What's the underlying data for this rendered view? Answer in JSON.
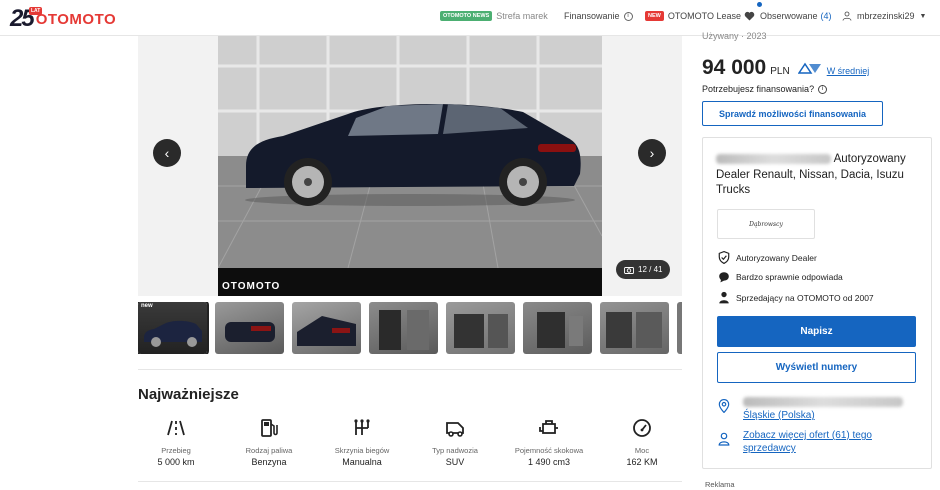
{
  "header": {
    "logo_25": "25",
    "logo_lat": "LAT",
    "logo_text": "OTOMOTO",
    "nav_news_badge": "OTOMOTO NEWS",
    "nav_strefa": "Strefa marek",
    "nav_finansowanie": "Finansowanie",
    "nav_new_badge": "NEW",
    "nav_lease": "OTOMOTO Lease",
    "nav_obserwowane": "Obserwowane",
    "nav_obserwowane_count": "(4)",
    "nav_user": "mbrzezinski29"
  },
  "gallery": {
    "watermark": "OTOMOTO",
    "counter": "12 / 41",
    "thumb_badge": "new"
  },
  "listing": {
    "status_line": "Używany · 2023",
    "price": "94 000",
    "currency": "PLN",
    "price_rating": "W średniej",
    "financing_question": "Potrzebujesz finansowania?",
    "financing_button": "Sprawdź możliwości finansowania"
  },
  "highlights": {
    "title": "Najważniejsze",
    "specs": [
      {
        "label": "Przebieg",
        "value": "5 000 km",
        "icon": "road-icon"
      },
      {
        "label": "Rodzaj paliwa",
        "value": "Benzyna",
        "icon": "fuel-pump-icon"
      },
      {
        "label": "Skrzynia biegów",
        "value": "Manualna",
        "icon": "gearbox-icon"
      },
      {
        "label": "Typ nadwozia",
        "value": "SUV",
        "icon": "car-body-icon"
      },
      {
        "label": "Pojemność skokowa",
        "value": "1 490 cm3",
        "icon": "engine-icon"
      },
      {
        "label": "Moc",
        "value": "162 KM",
        "icon": "speedometer-icon"
      }
    ]
  },
  "seller": {
    "name_suffix": "Autoryzowany Dealer Renault, Nissan, Dacia, Isuzu Trucks",
    "logo_text": "Dąbrowscy",
    "features": [
      {
        "text": "Autoryzowany Dealer",
        "icon": "shield-check-icon"
      },
      {
        "text": "Bardzo sprawnie odpowiada",
        "icon": "chat-bubble-icon"
      },
      {
        "text": "Sprzedający na OTOMOTO od 2007",
        "icon": "person-icon"
      }
    ],
    "write_button": "Napisz",
    "show_numbers_button": "Wyświetl numery",
    "location_suffix": "Śląskie (Polska)",
    "more_offers": "Zobacz więcej ofert (61) tego sprzedawcy"
  },
  "ads_label": "Reklama",
  "colors": {
    "brand_red": "#e53935",
    "primary_blue": "#1565c0",
    "news_green": "#4caf72"
  }
}
